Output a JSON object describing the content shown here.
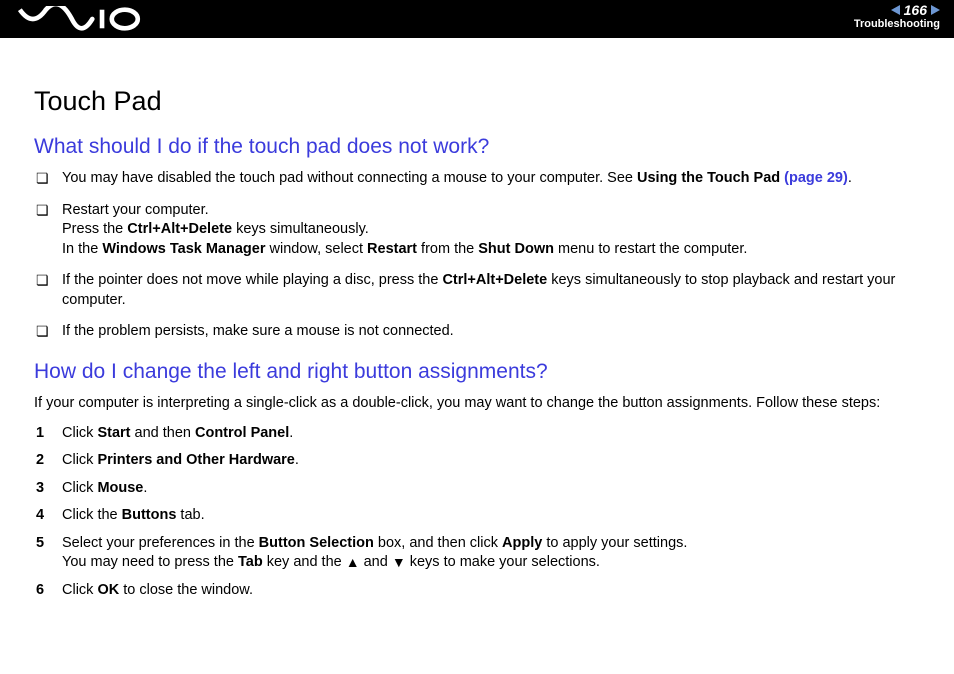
{
  "header": {
    "page_number": "166",
    "section": "Troubleshooting"
  },
  "page_title": "Touch Pad",
  "q1": {
    "heading": "What should I do if the touch pad does not work?",
    "items": [
      {
        "pre": "You may have disabled the touch pad without connecting a mouse to your computer. See ",
        "bold1": "Using the Touch Pad",
        "link": " (page 29)",
        "post": "."
      },
      {
        "line1": "Restart your computer.",
        "line2a": "Press the ",
        "line2b": "Ctrl+Alt+Delete",
        "line2c": " keys simultaneously.",
        "line3a": "In the ",
        "line3b": "Windows Task Manager",
        "line3c": " window, select ",
        "line3d": "Restart",
        "line3e": " from the ",
        "line3f": "Shut Down",
        "line3g": " menu to restart the computer."
      },
      {
        "a": "If the pointer does not move while playing a disc, press the ",
        "b": "Ctrl+Alt+Delete",
        "c": " keys simultaneously to stop playback and restart your computer."
      },
      {
        "text": "If the problem persists, make sure a mouse is not connected."
      }
    ]
  },
  "q2": {
    "heading": "How do I change the left and right button assignments?",
    "intro": "If your computer is interpreting a single-click as a double-click, you may want to change the button assignments. Follow these steps:",
    "steps": [
      {
        "n": "1",
        "a": "Click ",
        "b": "Start",
        "c": " and then ",
        "d": "Control Panel",
        "e": "."
      },
      {
        "n": "2",
        "a": "Click ",
        "b": "Printers and Other Hardware",
        "c": "."
      },
      {
        "n": "3",
        "a": "Click ",
        "b": "Mouse",
        "c": "."
      },
      {
        "n": "4",
        "a": "Click the ",
        "b": "Buttons",
        "c": " tab."
      },
      {
        "n": "5",
        "a": "Select your preferences in the ",
        "b": "Button Selection",
        "c": " box, and then click ",
        "d": "Apply",
        "e": " to apply your settings.",
        "l2a": "You may need to press the ",
        "l2b": "Tab",
        "l2c": " key and the ",
        "up": "▲",
        "l2d": " and ",
        "down": "▼",
        "l2e": " keys to make your selections."
      },
      {
        "n": "6",
        "a": "Click ",
        "b": "OK",
        "c": " to close the window."
      }
    ]
  }
}
